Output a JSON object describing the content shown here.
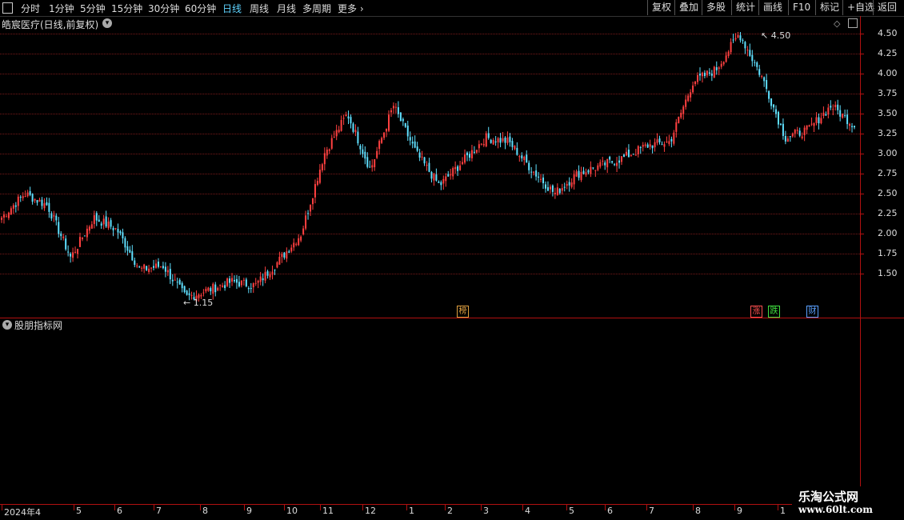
{
  "toolbar": {
    "left_items": [
      {
        "label": "分时",
        "x": 26,
        "active": false
      },
      {
        "label": "1分钟",
        "x": 61,
        "active": false
      },
      {
        "label": "5分钟",
        "x": 100,
        "active": false
      },
      {
        "label": "15分钟",
        "x": 139,
        "active": false
      },
      {
        "label": "30分钟",
        "x": 185,
        "active": false
      },
      {
        "label": "60分钟",
        "x": 231,
        "active": false
      },
      {
        "label": "日线",
        "x": 278,
        "active": true
      },
      {
        "label": "周线",
        "x": 312,
        "active": false
      },
      {
        "label": "月线",
        "x": 346,
        "active": false
      },
      {
        "label": "多周期",
        "x": 378,
        "active": false
      },
      {
        "label": "更多",
        "x": 422,
        "active": false
      }
    ],
    "right_items": [
      "复权",
      "叠加",
      "多股",
      "统计",
      "画线",
      "F10",
      "标记",
      "+自选",
      "返回"
    ]
  },
  "chart": {
    "title": "皓宸医疗(日线,前复权)",
    "high_label": "4.50",
    "low_label": "1.15",
    "price_axis": [
      "4.50",
      "4.25",
      "4.00",
      "3.75",
      "3.50",
      "3.25",
      "3.00",
      "2.75",
      "2.50",
      "2.25",
      "2.00",
      "1.75",
      "1.50"
    ],
    "tags": [
      {
        "text": "榜",
        "color": "#e0a040",
        "border": "#e0a040"
      },
      {
        "text": "涨",
        "color": "#ff5050",
        "border": "#ff5050"
      },
      {
        "text": "跌",
        "color": "#40e040",
        "border": "#40e040"
      },
      {
        "text": "财",
        "color": "#5aa0ff",
        "border": "#5aa0ff"
      }
    ]
  },
  "indicator": {
    "title": "股朋指标网"
  },
  "time_axis": [
    "2024年4",
    "5",
    "6",
    "7",
    "8",
    "9",
    "10",
    "11",
    "12",
    "1",
    "2",
    "3",
    "4",
    "5",
    "6",
    "7",
    "8",
    "9",
    "1"
  ],
  "watermark": {
    "line1": "乐淘公式网",
    "line2": "www.60lt.com"
  },
  "colors": {
    "up": "#ff4040",
    "down": "#5fe0ff",
    "grid": "#7a1818",
    "axis": "#b01010",
    "active": "#5fd4ff"
  },
  "chart_data": {
    "type": "candlestick",
    "title": "皓宸医疗(日线,前复权)",
    "ylim": [
      1.15,
      4.55
    ],
    "x_labels": [
      "2024年4",
      "5",
      "6",
      "7",
      "8",
      "9",
      "10",
      "11",
      "12",
      "1",
      "2",
      "3",
      "4",
      "5",
      "6",
      "7",
      "8",
      "9",
      "1"
    ],
    "anchors": [
      2.2,
      2.5,
      2.35,
      1.7,
      2.2,
      2.05,
      1.55,
      1.6,
      1.2,
      1.3,
      1.4,
      1.35,
      1.65,
      2.0,
      3.0,
      3.5,
      2.8,
      3.6,
      3.0,
      2.6,
      2.9,
      3.2,
      3.15,
      2.8,
      2.5,
      2.75,
      2.85,
      2.95,
      3.1,
      3.15,
      3.9,
      4.05,
      4.5,
      3.95,
      3.2,
      3.3,
      3.6,
      3.35
    ],
    "high": 4.5,
    "low": 1.15
  }
}
